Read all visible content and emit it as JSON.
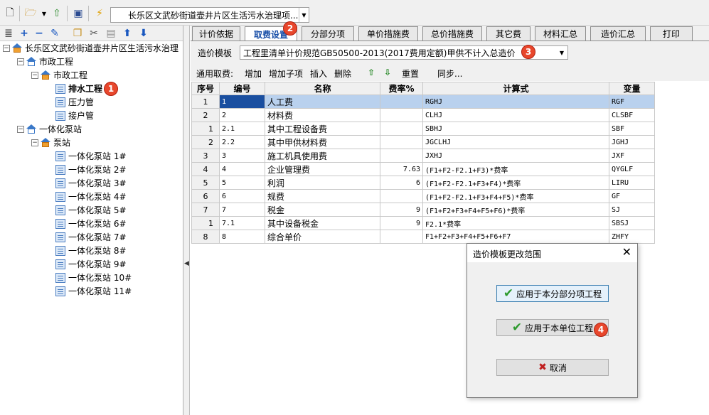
{
  "toolbar": {
    "project_combo": "长乐区文武砂街道壶井片区生活污水治理项..."
  },
  "tree": {
    "root": "长乐区文武砂街道壶井片区生活污水治理",
    "n1": "市政工程",
    "n1_1": "市政工程",
    "n1_1_1": "排水工程",
    "n1_1_2": "压力管",
    "n1_1_3": "接户管",
    "n2": "一体化泵站",
    "n2_1": "泵站",
    "stations": [
      "一体化泵站 1#",
      "一体化泵站 2#",
      "一体化泵站 3#",
      "一体化泵站 4#",
      "一体化泵站 5#",
      "一体化泵站 6#",
      "一体化泵站 7#",
      "一体化泵站 8#",
      "一体化泵站 9#",
      "一体化泵站 10#",
      "一体化泵站 11#"
    ]
  },
  "badges": {
    "b1": "1",
    "b2": "2",
    "b3": "3",
    "b4": "4"
  },
  "tabs": [
    "计价依据",
    "取费设置",
    "分部分项",
    "单价措施费",
    "总价措施费",
    "其它费",
    "材料汇总",
    "造价汇总",
    "打印"
  ],
  "template": {
    "label": "造价模板",
    "value": "工程里清单计价规范GB50500-2013(2017费用定额)甲供不计入总造价"
  },
  "fee_tools": {
    "label": "通用取费:",
    "add": "增加",
    "add_child": "增加子项",
    "insert": "插入",
    "delete": "删除",
    "reset": "重置",
    "sync": "同步..."
  },
  "grid": {
    "headers": [
      "序号",
      "编号",
      "名称",
      "费率%",
      "计算式",
      "变量"
    ],
    "rows": [
      {
        "rn": "1",
        "code": "1",
        "name": "人工费",
        "rate": "",
        "formula": "RGHJ",
        "var": "RGF"
      },
      {
        "rn": "2",
        "code": "2",
        "name": "材料费",
        "rate": "",
        "formula": "CLHJ",
        "var": "CLSBF"
      },
      {
        "rn": "1",
        "code": "2.1",
        "name": "其中工程设备费",
        "rate": "",
        "formula": "SBHJ",
        "var": "SBF"
      },
      {
        "rn": "2",
        "code": "2.2",
        "name": "其中甲供材料费",
        "rate": "",
        "formula": "JGCLHJ",
        "var": "JGHJ"
      },
      {
        "rn": "3",
        "code": "3",
        "name": "施工机具使用费",
        "rate": "",
        "formula": "JXHJ",
        "var": "JXF"
      },
      {
        "rn": "4",
        "code": "4",
        "name": "企业管理费",
        "rate": "7.63",
        "formula": "(F1+F2-F2.1+F3)*费率",
        "var": "QYGLF"
      },
      {
        "rn": "5",
        "code": "5",
        "name": "利润",
        "rate": "6",
        "formula": "(F1+F2-F2.1+F3+F4)*费率",
        "var": "LIRU"
      },
      {
        "rn": "6",
        "code": "6",
        "name": "规费",
        "rate": "",
        "formula": "(F1+F2-F2.1+F3+F4+F5)*费率",
        "var": "GF"
      },
      {
        "rn": "7",
        "code": "7",
        "name": "税金",
        "rate": "9",
        "formula": "(F1+F2+F3+F4+F5+F6)*费率",
        "var": "SJ"
      },
      {
        "rn": "1",
        "code": "7.1",
        "name": "其中设备税金",
        "rate": "9",
        "formula": "F2.1*费率",
        "var": "SBSJ"
      },
      {
        "rn": "8",
        "code": "8",
        "name": "综合单价",
        "rate": "",
        "formula": "F1+F2+F3+F4+F5+F6+F7",
        "var": "ZHFY"
      }
    ]
  },
  "dialog": {
    "title": "造价模板更改范围",
    "btn_section": "应用于本分部分项工程",
    "btn_unit": "应用于本单位工程",
    "btn_cancel": "取消"
  }
}
